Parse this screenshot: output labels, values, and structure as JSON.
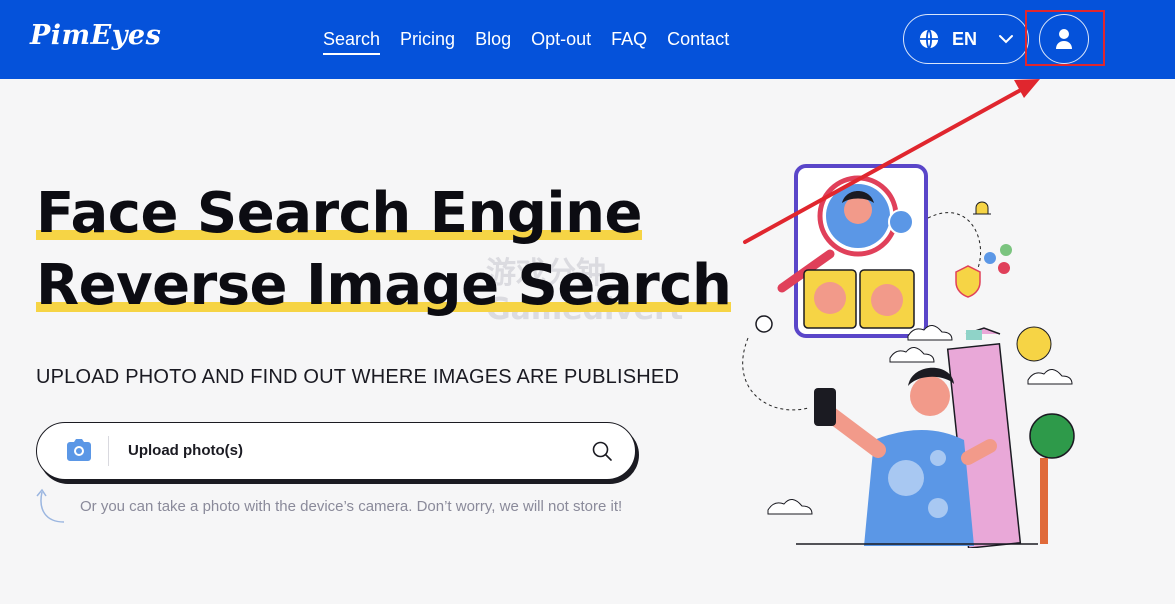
{
  "header": {
    "logo": "PimEyes",
    "nav": [
      {
        "label": "Search",
        "active": true
      },
      {
        "label": "Pricing"
      },
      {
        "label": "Blog"
      },
      {
        "label": "Opt-out"
      },
      {
        "label": "FAQ"
      },
      {
        "label": "Contact"
      }
    ],
    "language": "EN",
    "icons": {
      "globe": "globe-icon",
      "chevron": "chevron-down-icon",
      "user": "user-icon"
    }
  },
  "hero": {
    "title_line1": "Face Search Engine",
    "title_line2": "Reverse Image Search",
    "subtitle": "UPLOAD PHOTO AND FIND OUT WHERE IMAGES ARE PUBLISHED"
  },
  "upload": {
    "label": "Upload photo(s)",
    "hint": "Or you can take a photo with the device’s camera. Don’t worry, we will not store it!"
  },
  "watermark": {
    "line1": "游戏分钟",
    "line2": "Gamedivert"
  },
  "colors": {
    "primary": "#0552da",
    "highlight": "#f6d445",
    "annotation": "#e0262e",
    "background": "#f6f6f7"
  }
}
